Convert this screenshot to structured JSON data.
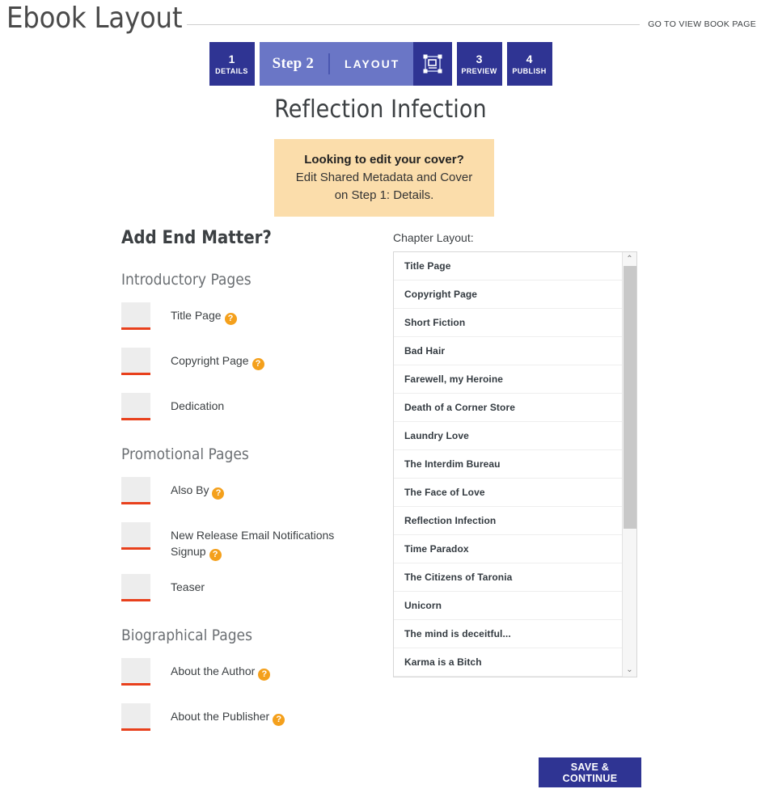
{
  "header": {
    "title": "Ebook Layout",
    "view_book_link": "GO TO VIEW BOOK PAGE"
  },
  "steps": {
    "step1": {
      "number": "1",
      "label": "DETAILS"
    },
    "active": {
      "number": "Step 2",
      "name": "LAYOUT",
      "icon": "layout-frame-icon"
    },
    "step3": {
      "number": "3",
      "label": "PREVIEW"
    },
    "step4": {
      "number": "4",
      "label": "PUBLISH"
    }
  },
  "book": {
    "title": "Reflection Infection"
  },
  "notice": {
    "title": "Looking to edit your cover?",
    "line1": "Edit Shared Metadata and Cover",
    "line2": "on Step 1: Details."
  },
  "end_matter": {
    "heading": "Add End Matter?",
    "groups": [
      {
        "heading": "Introductory Pages",
        "items": [
          {
            "label": "Title Page",
            "help": true,
            "checked": false
          },
          {
            "label": "Copyright Page",
            "help": true,
            "checked": false
          },
          {
            "label": "Dedication",
            "help": false,
            "checked": false
          }
        ]
      },
      {
        "heading": "Promotional Pages",
        "items": [
          {
            "label": "Also By",
            "help": true,
            "checked": false
          },
          {
            "label": "New Release Email Notifications Signup",
            "help": true,
            "checked": false
          },
          {
            "label": "Teaser",
            "help": false,
            "checked": false
          }
        ]
      },
      {
        "heading": "Biographical Pages",
        "items": [
          {
            "label": "About the Author",
            "help": true,
            "checked": false
          },
          {
            "label": "About the Publisher",
            "help": true,
            "checked": false
          }
        ]
      }
    ]
  },
  "chapter_layout": {
    "caption": "Chapter Layout:",
    "items": [
      "Title Page",
      "Copyright Page",
      "Short Fiction",
      "Bad Hair",
      "Farewell, my Heroine",
      "Death of a Corner Store",
      "Laundry Love",
      "The Interdim Bureau",
      "The Face of Love",
      "Reflection Infection",
      "Time Paradox",
      "The Citizens of Taronia",
      "Unicorn",
      "The mind is deceitful...",
      "Karma is a Bitch"
    ],
    "scroll_up_glyph": "⌃",
    "scroll_down_glyph": "⌄"
  },
  "footer": {
    "save_label": "SAVE & CONTINUE"
  },
  "colors": {
    "brand_dark": "#2f3493",
    "brand_light": "#6a76c6",
    "notice_bg": "#fbddab",
    "checkbox_underline": "#e8401c",
    "help_icon": "#f4a01c"
  },
  "help_glyph": "?"
}
